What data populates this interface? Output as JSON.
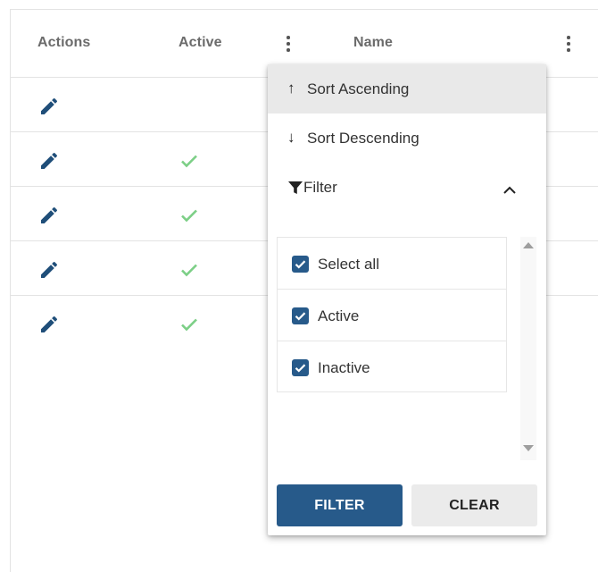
{
  "header": {
    "actions": "Actions",
    "active": "Active",
    "name": "Name"
  },
  "rows": [
    {
      "active": false
    },
    {
      "active": true
    },
    {
      "active": true
    },
    {
      "active": true
    },
    {
      "active": true
    }
  ],
  "menu": {
    "sort_ascending": "Sort Ascending",
    "sort_descending": "Sort Descending",
    "filter": "Filter",
    "options": [
      {
        "label": "Select all",
        "checked": true
      },
      {
        "label": "Active",
        "checked": true
      },
      {
        "label": "Inactive",
        "checked": true
      }
    ],
    "filter_button": "FILTER",
    "clear_button": "CLEAR"
  },
  "colors": {
    "primary": "#275a8a",
    "check_green": "#7ccf86",
    "edit_icon": "#1f4e79"
  }
}
